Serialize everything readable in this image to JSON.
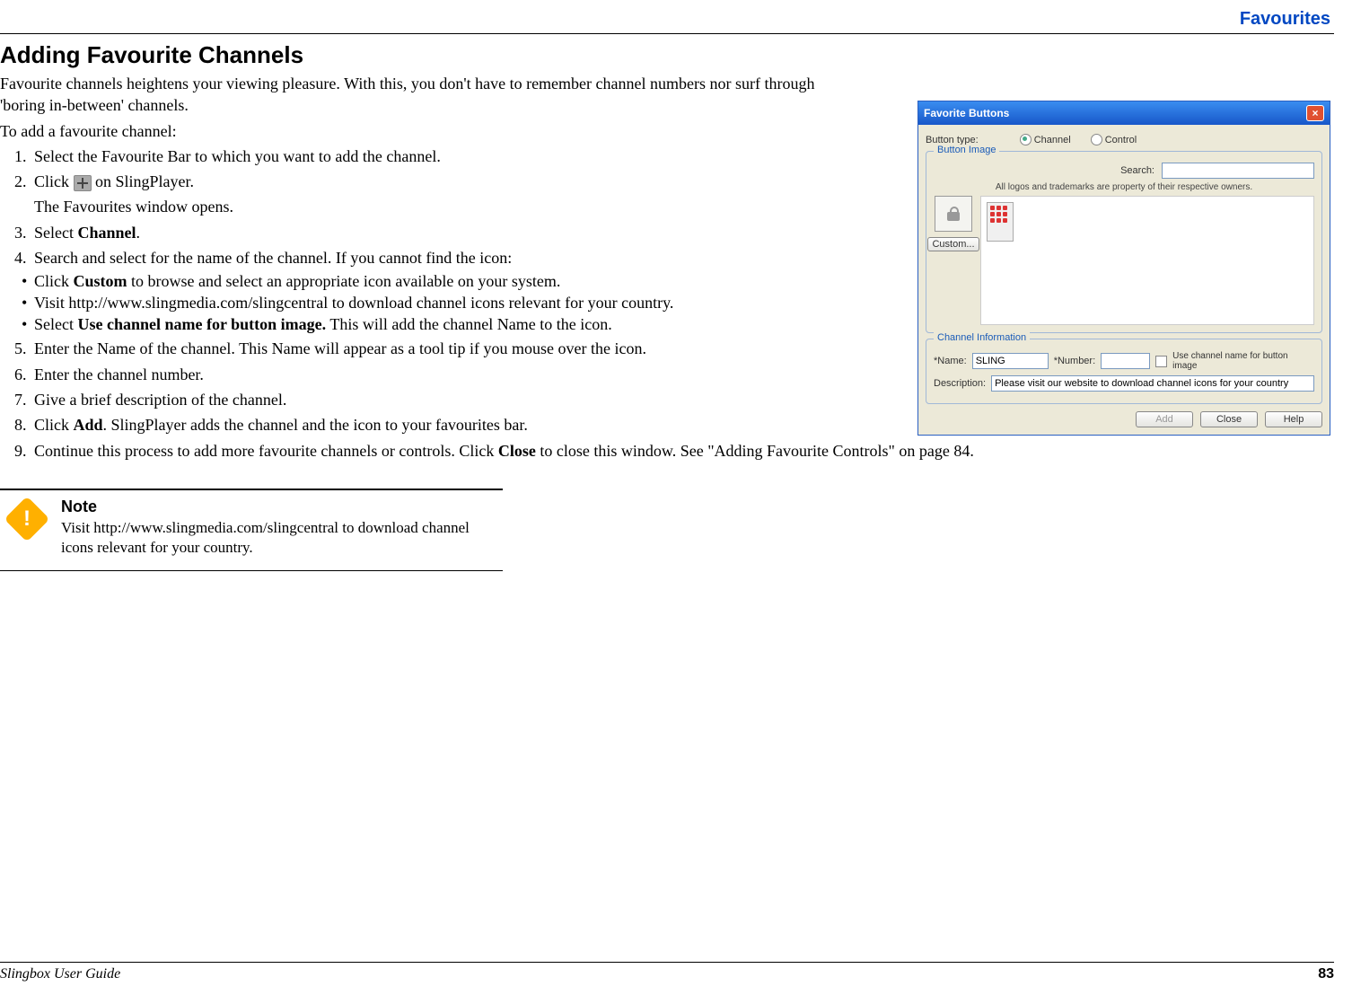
{
  "header": {
    "section": "Favourites"
  },
  "heading": "Adding Favourite Channels",
  "intro": "Favourite channels heightens your viewing pleasure. With this, you don't have to remember channel numbers nor surf through 'boring in-between' channels.",
  "lead": "To add a favourite channel:",
  "steps": {
    "s1": "Select the Favourite Bar to which you want to add the channel.",
    "s2a": "Click ",
    "s2b": " on SlingPlayer.",
    "s2sub": "The Favourites window opens.",
    "s3a": "Select ",
    "s3bold": "Channel",
    "s3b": ".",
    "s4": "Search and select for the name of the channel. If you cannot find the icon:",
    "b1a": "Click ",
    "b1bold": "Custom",
    "b1b": " to browse and select an appropriate icon available on your system.",
    "b2": "Visit http://www.slingmedia.com/slingcentral to download channel icons relevant for your country.",
    "b3a": "Select ",
    "b3bold": "Use channel name for button image.",
    "b3b": " This will add the channel Name to the icon.",
    "s5": "Enter the Name of the channel. This Name will appear as a tool tip if you mouse over the icon.",
    "s6": "Enter the channel number.",
    "s7": "Give a brief description of the channel.",
    "s8a": "Click ",
    "s8bold": "Add",
    "s8b": ". SlingPlayer adds the channel and the icon to your favourites bar.",
    "s9a": "Continue this process to add more favourite channels or controls. Click ",
    "s9bold": "Close",
    "s9b": " to close this window. See \"Adding Favourite Controls\" on page 84."
  },
  "note": {
    "title": "Note",
    "body": "Visit http://www.slingmedia.com/slingcentral to download channel icons relevant for your country."
  },
  "footer": {
    "guide": "Slingbox User Guide",
    "page": "83"
  },
  "dialog": {
    "title": "Favorite Buttons",
    "button_type_label": "Button type:",
    "radio_channel": "Channel",
    "radio_control": "Control",
    "group_image": "Button Image",
    "search_label": "Search:",
    "trademark": "All logos and trademarks are property of their respective owners.",
    "custom_btn": "Custom...",
    "group_info": "Channel Information",
    "name_label": "*Name:",
    "name_value": "SLING",
    "number_label": "*Number:",
    "use_name_check": "Use channel name for button image",
    "desc_label": "Description:",
    "desc_value": "Please visit our website to download channel icons for your country",
    "btn_add": "Add",
    "btn_close": "Close",
    "btn_help": "Help"
  }
}
